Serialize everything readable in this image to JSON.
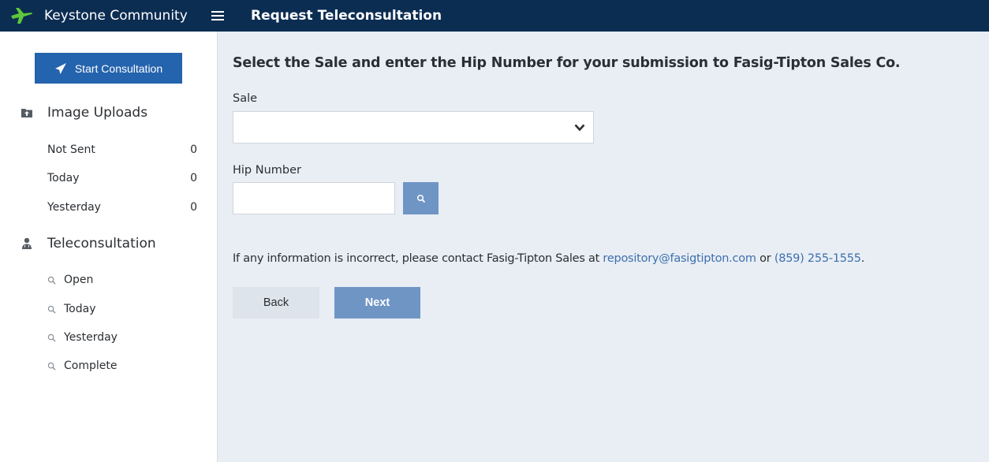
{
  "app": {
    "brand_name": "Keystone Community",
    "page_title": "Request Teleconsultation"
  },
  "colors": {
    "topbar": "#0c2d52",
    "accent": "#2463ad",
    "link": "#3e6fae",
    "button_muted": "#6f95c5",
    "logo_green": "#5cc83a"
  },
  "sidebar": {
    "start_button": {
      "label": "Start Consultation",
      "icon": "paper-plane-icon"
    },
    "image_uploads": {
      "label": "Image Uploads",
      "icon": "folder-upload-icon",
      "items": [
        {
          "label": "Not Sent",
          "count": "0"
        },
        {
          "label": "Today",
          "count": "0"
        },
        {
          "label": "Yesterday",
          "count": "0"
        }
      ]
    },
    "teleconsultation": {
      "label": "Teleconsultation",
      "icon": "doctor-icon",
      "items": [
        {
          "label": "Open",
          "icon": "search-icon"
        },
        {
          "label": "Today",
          "icon": "search-icon"
        },
        {
          "label": "Yesterday",
          "icon": "search-icon"
        },
        {
          "label": "Complete",
          "icon": "search-icon"
        }
      ]
    }
  },
  "main": {
    "heading": "Select the Sale and enter the Hip Number for your submission to Fasig-Tipton Sales Co.",
    "sale": {
      "label": "Sale",
      "value": ""
    },
    "hip": {
      "label": "Hip Number",
      "value": ""
    },
    "info": {
      "prefix": "If any information is incorrect, please contact Fasig-Tipton Sales at ",
      "email": "repository@fasigtipton.com",
      "middle": " or ",
      "phone": "(859) 255-1555",
      "suffix": "."
    },
    "back_label": "Back",
    "next_label": "Next"
  }
}
